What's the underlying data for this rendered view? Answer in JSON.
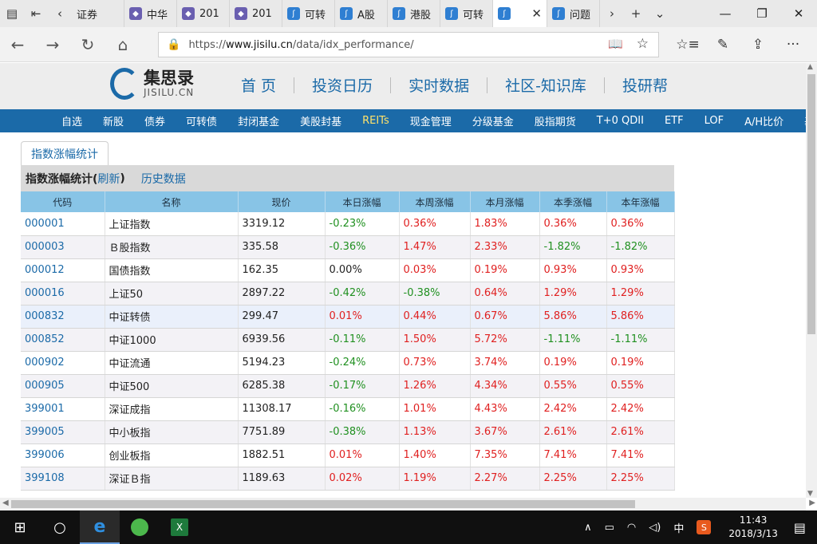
{
  "browser": {
    "tabs": [
      {
        "label": "证券",
        "icon": "none"
      },
      {
        "label": "中华",
        "icon": "globe-icon"
      },
      {
        "label": "201",
        "icon": "globe-icon"
      },
      {
        "label": "201",
        "icon": "globe-icon"
      },
      {
        "label": "可转",
        "icon": "jisilu-icon"
      },
      {
        "label": "A股",
        "icon": "jisilu-icon"
      },
      {
        "label": "港股",
        "icon": "jisilu-icon"
      },
      {
        "label": "可转",
        "icon": "jisilu-icon"
      },
      {
        "label": "",
        "icon": "jisilu-icon",
        "active": true
      },
      {
        "label": "问题",
        "icon": "jisilu-icon"
      }
    ],
    "url_prefix": "https://",
    "url_host": "www.jisilu.cn",
    "url_path": "/data/idx_performance/"
  },
  "site": {
    "logo_cn": "集思录",
    "logo_en": "JISILU.CN",
    "main_nav": [
      "首 页",
      "投资日历",
      "实时数据",
      "社区-知识库",
      "投研帮"
    ],
    "sub_nav": [
      "自选",
      "新股",
      "债券",
      "可转债",
      "封闭基金",
      "美股封基",
      "REITs",
      "现金管理",
      "分级基金",
      "股指期货",
      "T+0 QDII",
      "ETF",
      "LOF",
      "A/H比价",
      "基"
    ],
    "highlight_nav": "REITs"
  },
  "page": {
    "tab_label": "指数涨幅统计",
    "table_title": "指数涨幅统计(",
    "refresh_label": "刷新",
    "table_title_end": " )",
    "history_label": "历史数据",
    "columns": [
      "代码",
      "名称",
      "现价",
      "本日涨幅",
      "本周涨幅",
      "本月涨幅",
      "本季涨幅",
      "本年涨幅"
    ],
    "rows": [
      [
        "000001",
        "上证指数",
        "3319.12",
        "-0.23%",
        "0.36%",
        "1.83%",
        "0.36%",
        "0.36%"
      ],
      [
        "000003",
        "Ｂ股指数",
        "335.58",
        "-0.36%",
        "1.47%",
        "2.33%",
        "-1.82%",
        "-1.82%"
      ],
      [
        "000012",
        "国债指数",
        "162.35",
        "0.00%",
        "0.03%",
        "0.19%",
        "0.93%",
        "0.93%"
      ],
      [
        "000016",
        "上证50",
        "2897.22",
        "-0.42%",
        "-0.38%",
        "0.64%",
        "1.29%",
        "1.29%"
      ],
      [
        "000832",
        "中证转债",
        "299.47",
        "0.01%",
        "0.44%",
        "0.67%",
        "5.86%",
        "5.86%"
      ],
      [
        "000852",
        "中证1000",
        "6939.56",
        "-0.11%",
        "1.50%",
        "5.72%",
        "-1.11%",
        "-1.11%"
      ],
      [
        "000902",
        "中证流通",
        "5194.23",
        "-0.24%",
        "0.73%",
        "3.74%",
        "0.19%",
        "0.19%"
      ],
      [
        "000905",
        "中证500",
        "6285.38",
        "-0.17%",
        "1.26%",
        "4.34%",
        "0.55%",
        "0.55%"
      ],
      [
        "399001",
        "深证成指",
        "11308.17",
        "-0.16%",
        "1.01%",
        "4.43%",
        "2.42%",
        "2.42%"
      ],
      [
        "399005",
        "中小板指",
        "7751.89",
        "-0.38%",
        "1.13%",
        "3.67%",
        "2.61%",
        "2.61%"
      ],
      [
        "399006",
        "创业板指",
        "1882.51",
        "0.01%",
        "1.40%",
        "7.35%",
        "7.41%",
        "7.41%"
      ],
      [
        "399108",
        "深证Ｂ指",
        "1189.63",
        "0.02%",
        "1.19%",
        "2.27%",
        "2.25%",
        "2.25%"
      ]
    ]
  },
  "taskbar": {
    "ime_label": "中",
    "ime_app": "S",
    "time": "11:43",
    "date": "2018/3/13"
  },
  "colors": {
    "brand_blue": "#1b6aa8",
    "positive": "#e02020",
    "negative": "#209020",
    "header_bg": "#88c4e6"
  }
}
